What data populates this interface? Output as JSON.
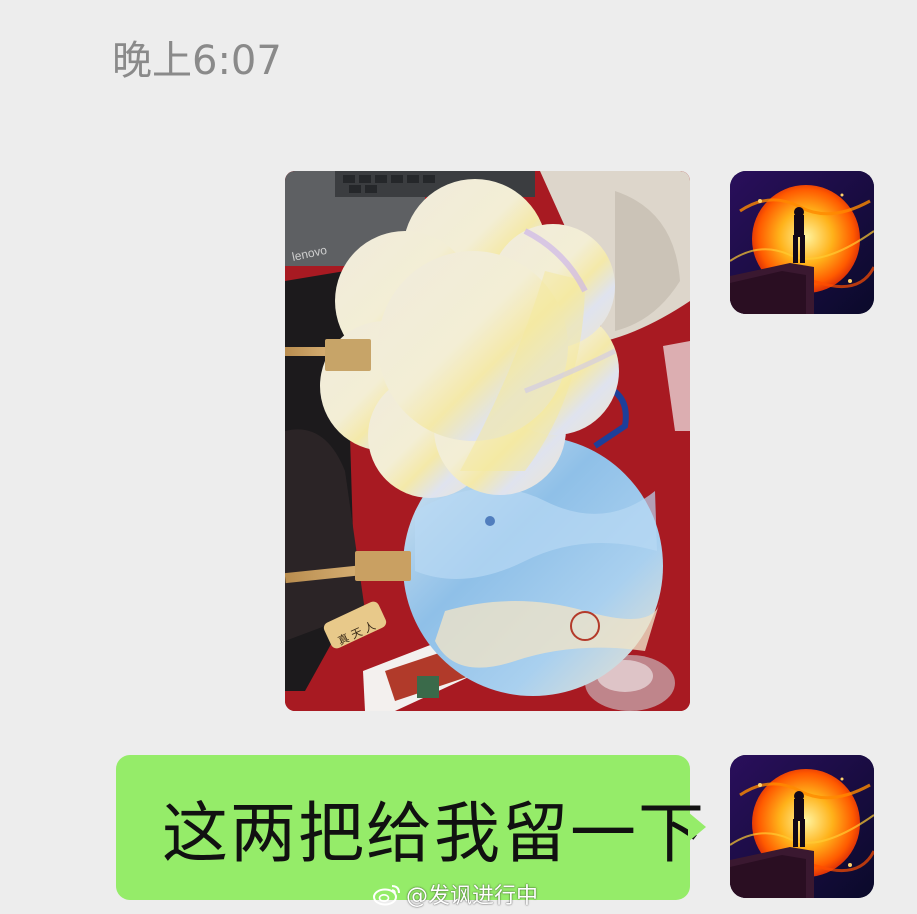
{
  "chat": {
    "timestamp": "晚上6:07",
    "messages": [
      {
        "type": "image",
        "sender": "self",
        "description_icon": "photo-icon"
      },
      {
        "type": "text",
        "sender": "self",
        "text": "这两把给我留一下"
      }
    ]
  },
  "watermark": {
    "icon": "weibo-icon",
    "text": "@发讽进行中"
  },
  "colors": {
    "background": "#ededed",
    "self_bubble": "#95ec69",
    "timestamp_text": "#8a8a8a"
  }
}
